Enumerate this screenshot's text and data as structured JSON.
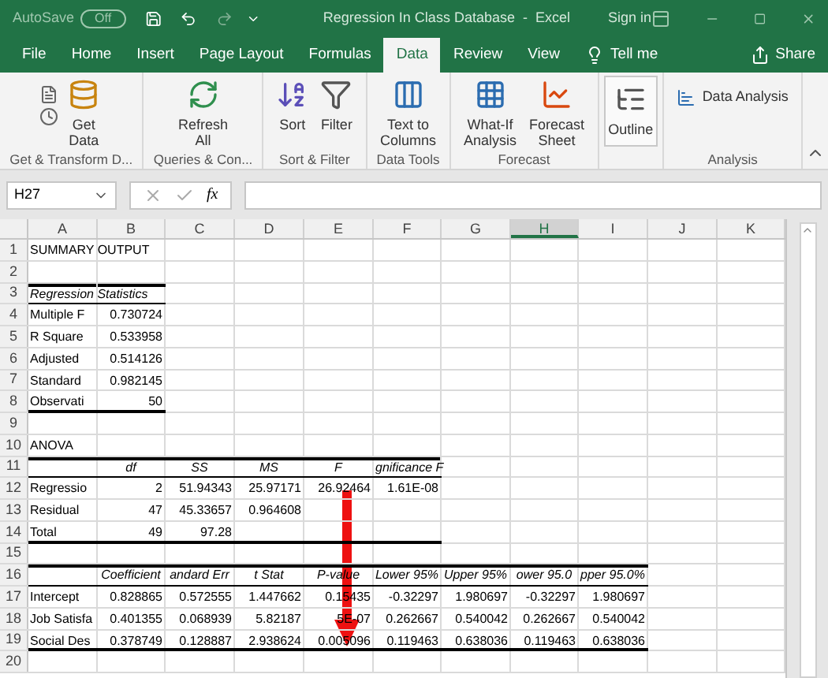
{
  "titlebar": {
    "autosave_label": "AutoSave",
    "autosave_toggle": "Off",
    "autosave_on": false,
    "title": "Regression In Class Database  -  Excel",
    "sign_in": "Sign in"
  },
  "tabs": [
    {
      "label": "File",
      "selected": false
    },
    {
      "label": "Home",
      "selected": false
    },
    {
      "label": "Insert",
      "selected": false
    },
    {
      "label": "Page Layout",
      "selected": false
    },
    {
      "label": "Formulas",
      "selected": false
    },
    {
      "label": "Data",
      "selected": true
    },
    {
      "label": "Review",
      "selected": false
    },
    {
      "label": "View",
      "selected": false
    }
  ],
  "tell_me": "Tell me",
  "share": "Share",
  "ribbon_groups": [
    {
      "label": "Get & Transform D...",
      "buttons": [
        {
          "kind": "getdata",
          "lines": [
            "Get",
            "Data"
          ]
        }
      ]
    },
    {
      "label": "Queries & Con...",
      "buttons": [
        {
          "kind": "refresh",
          "lines": [
            "Refresh",
            "All"
          ]
        }
      ]
    },
    {
      "label": "Sort & Filter",
      "buttons": [
        {
          "kind": "sort",
          "lines": [
            "Sort"
          ]
        },
        {
          "kind": "filter",
          "lines": [
            "Filter"
          ]
        }
      ]
    },
    {
      "label": "Data Tools",
      "buttons": [
        {
          "kind": "textcols",
          "lines": [
            "Text to",
            "Columns"
          ]
        }
      ]
    },
    {
      "label": "Forecast",
      "buttons": [
        {
          "kind": "whatif",
          "lines": [
            "What-If",
            "Analysis"
          ]
        },
        {
          "kind": "forecast",
          "lines": [
            "Forecast",
            "Sheet"
          ]
        }
      ]
    },
    {
      "kind": "outline",
      "buttons": [
        {
          "kind": "outline",
          "lines": [
            "Outline"
          ]
        }
      ]
    },
    {
      "label": "Analysis",
      "buttons": [
        {
          "kind": "analysis",
          "lines": [
            "Data Analysis"
          ]
        }
      ]
    }
  ],
  "name_box": "H27",
  "formula_symbol": "fx",
  "columns": [
    {
      "label": "A",
      "selected": false
    },
    {
      "label": "B",
      "selected": false
    },
    {
      "label": "C",
      "selected": false
    },
    {
      "label": "D",
      "selected": false
    },
    {
      "label": "E",
      "selected": false
    },
    {
      "label": "F",
      "selected": false
    },
    {
      "label": "G",
      "selected": false
    },
    {
      "label": "H",
      "selected": true
    },
    {
      "label": "I",
      "selected": false
    },
    {
      "label": "J",
      "selected": false
    },
    {
      "label": "K",
      "selected": false
    }
  ],
  "rows": [
    {
      "number": "1",
      "cells": [
        {
          "kind": "spill",
          "text": "SUMMARY OUTPUT"
        }
      ]
    },
    {
      "number": "2",
      "cells": []
    },
    {
      "number": "3",
      "top_rule": true,
      "header_rule": true,
      "cells": [
        {
          "kind": "spill-italic",
          "text": "Regression Statistics"
        },
        {
          "kind": "empty"
        }
      ]
    },
    {
      "number": "4",
      "cells": [
        {
          "kind": "text",
          "text": "Multiple F"
        },
        {
          "kind": "number",
          "text": "0.730724"
        }
      ]
    },
    {
      "number": "5",
      "cells": [
        {
          "kind": "text",
          "text": "R Square"
        },
        {
          "kind": "number",
          "text": "0.533958"
        }
      ]
    },
    {
      "number": "6",
      "cells": [
        {
          "kind": "text",
          "text": "Adjusted"
        },
        {
          "kind": "number",
          "text": "0.514126"
        }
      ]
    },
    {
      "number": "7",
      "cells": [
        {
          "kind": "text",
          "text": "Standard"
        },
        {
          "kind": "number",
          "text": "0.982145"
        }
      ]
    },
    {
      "number": "8",
      "bottom_rule": true,
      "cells": [
        {
          "kind": "text",
          "text": "Observati"
        },
        {
          "kind": "number",
          "text": "50"
        }
      ]
    },
    {
      "number": "9",
      "cells": []
    },
    {
      "number": "10",
      "cells": [
        {
          "kind": "spill",
          "text": "ANOVA"
        }
      ]
    },
    {
      "number": "11",
      "top_rule": true,
      "header_rule": true,
      "cells": [
        {
          "kind": "empty"
        },
        {
          "kind": "heading",
          "text": "df"
        },
        {
          "kind": "heading",
          "text": "SS"
        },
        {
          "kind": "heading",
          "text": "MS"
        },
        {
          "kind": "heading",
          "text": "F"
        },
        {
          "kind": "spill-italic",
          "text": "gnificance F"
        }
      ]
    },
    {
      "number": "12",
      "cells": [
        {
          "kind": "text",
          "text": "Regressio"
        },
        {
          "kind": "number",
          "text": "2"
        },
        {
          "kind": "number",
          "text": "51.94343"
        },
        {
          "kind": "number",
          "text": "25.97171"
        },
        {
          "kind": "number",
          "text": "26.92464"
        },
        {
          "kind": "number",
          "text": "1.61E-08"
        }
      ]
    },
    {
      "number": "13",
      "cells": [
        {
          "kind": "text",
          "text": "Residual"
        },
        {
          "kind": "number",
          "text": "47"
        },
        {
          "kind": "number",
          "text": "45.33657"
        },
        {
          "kind": "number",
          "text": "0.964608"
        }
      ]
    },
    {
      "number": "14",
      "bottom_rule": true,
      "cells": [
        {
          "kind": "text",
          "text": "Total"
        },
        {
          "kind": "number",
          "text": "49"
        },
        {
          "kind": "number",
          "text": "97.28"
        },
        {
          "kind": "empty"
        },
        {
          "kind": "empty"
        },
        {
          "kind": "empty"
        }
      ]
    },
    {
      "number": "15",
      "cells": []
    },
    {
      "number": "16",
      "top_rule": true,
      "header_rule": true,
      "cells": [
        {
          "kind": "empty"
        },
        {
          "kind": "heading",
          "text": "Coefficient"
        },
        {
          "kind": "heading",
          "text": "andard Err"
        },
        {
          "kind": "heading",
          "text": "t Stat"
        },
        {
          "kind": "heading",
          "text": "P-value"
        },
        {
          "kind": "heading",
          "text": "Lower 95%"
        },
        {
          "kind": "heading",
          "text": "Upper 95%"
        },
        {
          "kind": "heading",
          "text": "ower 95.0"
        },
        {
          "kind": "heading",
          "text": "pper 95.0%"
        }
      ]
    },
    {
      "number": "17",
      "cells": [
        {
          "kind": "text",
          "text": "Intercept"
        },
        {
          "kind": "number",
          "text": "0.828865"
        },
        {
          "kind": "number",
          "text": "0.572555"
        },
        {
          "kind": "number",
          "text": "1.447662"
        },
        {
          "kind": "number",
          "text": "0.15435"
        },
        {
          "kind": "number",
          "text": "-0.32297"
        },
        {
          "kind": "number",
          "text": "1.980697"
        },
        {
          "kind": "number",
          "text": "-0.32297"
        },
        {
          "kind": "number",
          "text": "1.980697"
        }
      ]
    },
    {
      "number": "18",
      "cells": [
        {
          "kind": "text",
          "text": "Job Satisfa"
        },
        {
          "kind": "number",
          "text": "0.401355"
        },
        {
          "kind": "number",
          "text": "0.068939"
        },
        {
          "kind": "number",
          "text": "5.82187"
        },
        {
          "kind": "number",
          "text": "5E-07"
        },
        {
          "kind": "number",
          "text": "0.262667"
        },
        {
          "kind": "number",
          "text": "0.540042"
        },
        {
          "kind": "number",
          "text": "0.262667"
        },
        {
          "kind": "number",
          "text": "0.540042"
        }
      ]
    },
    {
      "number": "19",
      "bottom_rule": true,
      "cells": [
        {
          "kind": "text",
          "text": "Social Des"
        },
        {
          "kind": "number",
          "text": "0.378749"
        },
        {
          "kind": "number",
          "text": "0.128887"
        },
        {
          "kind": "number",
          "text": "2.938624"
        },
        {
          "kind": "number",
          "text": "0.005096"
        },
        {
          "kind": "number",
          "text": "0.119463"
        },
        {
          "kind": "number",
          "text": "0.638036"
        },
        {
          "kind": "number",
          "text": "0.119463"
        },
        {
          "kind": "number",
          "text": "0.638036"
        }
      ]
    },
    {
      "number": "20",
      "cells": []
    }
  ]
}
